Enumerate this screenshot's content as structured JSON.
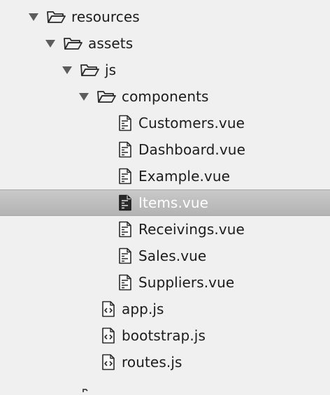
{
  "tree": {
    "items": [
      {
        "label": "resources",
        "type": "folder",
        "icon": "folder-open-icon",
        "expanded": true
      },
      {
        "label": "assets",
        "type": "folder",
        "icon": "folder-open-icon",
        "expanded": true
      },
      {
        "label": "js",
        "type": "folder",
        "icon": "folder-open-icon",
        "expanded": true
      },
      {
        "label": "components",
        "type": "folder",
        "icon": "folder-open-icon",
        "expanded": true
      },
      {
        "label": "Customers.vue",
        "type": "file",
        "icon": "vue-file-icon"
      },
      {
        "label": "Dashboard.vue",
        "type": "file",
        "icon": "vue-file-icon"
      },
      {
        "label": "Example.vue",
        "type": "file",
        "icon": "vue-file-icon"
      },
      {
        "label": "Items.vue",
        "type": "file",
        "icon": "vue-file-icon",
        "selected": true
      },
      {
        "label": "Receivings.vue",
        "type": "file",
        "icon": "vue-file-icon"
      },
      {
        "label": "Sales.vue",
        "type": "file",
        "icon": "vue-file-icon"
      },
      {
        "label": "Suppliers.vue",
        "type": "file",
        "icon": "vue-file-icon"
      },
      {
        "label": "app.js",
        "type": "file",
        "icon": "js-file-icon"
      },
      {
        "label": "bootstrap.js",
        "type": "file",
        "icon": "js-file-icon"
      },
      {
        "label": "routes.js",
        "type": "file",
        "icon": "js-file-icon"
      }
    ]
  },
  "colors": {
    "background": "#f0f0f0",
    "selection": "#b9b9b9",
    "text": "#1c1c1c",
    "selected_text": "#ffffff",
    "icon_stroke": "#2a2a2a"
  }
}
